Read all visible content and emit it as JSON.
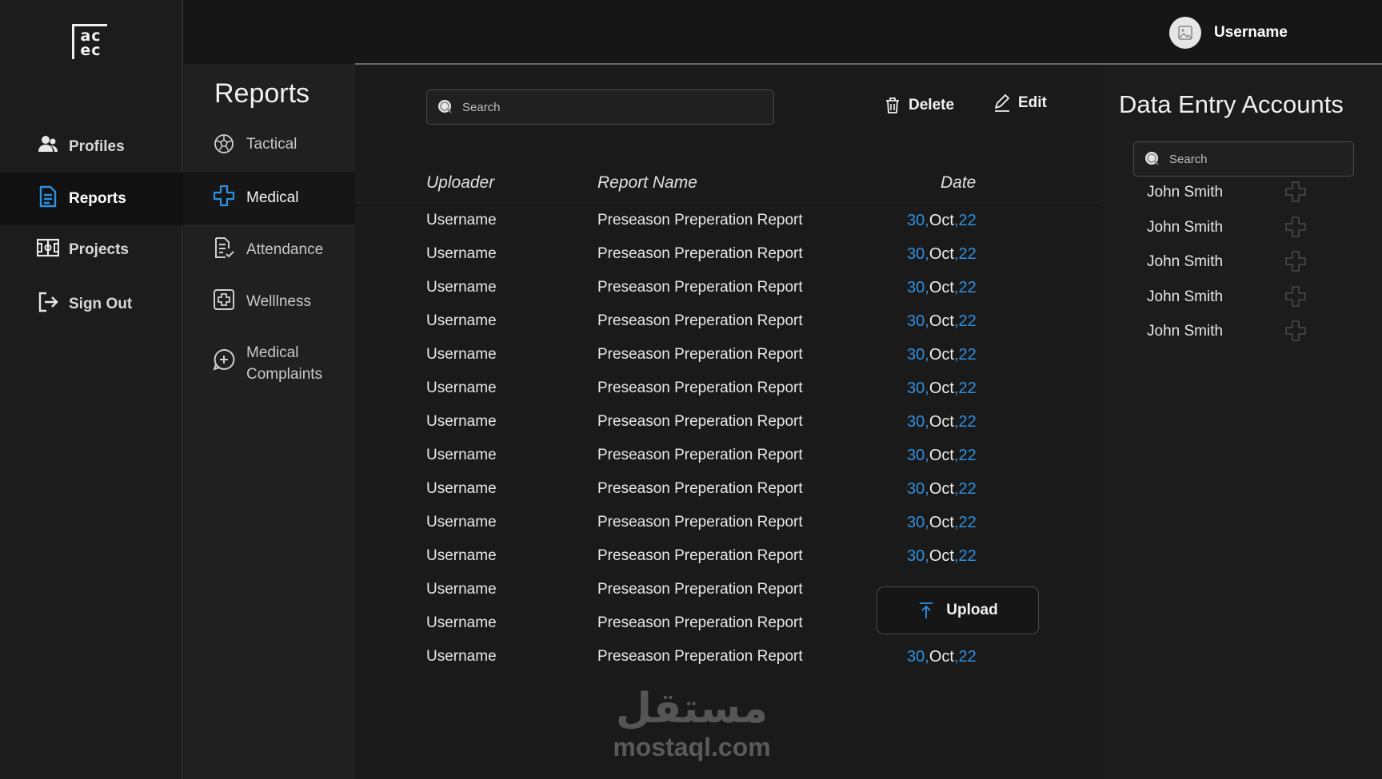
{
  "app": {
    "logo_text_top": "ac",
    "logo_text_bottom": "ec"
  },
  "user": {
    "name": "Username"
  },
  "sidebar": {
    "items": [
      {
        "label": "Profiles",
        "icon": "user-icon",
        "active": false
      },
      {
        "label": "Reports",
        "icon": "document-icon",
        "active": true
      },
      {
        "label": "Projects",
        "icon": "field-icon",
        "active": false
      },
      {
        "label": "Sign Out",
        "icon": "sign-out-icon",
        "active": false
      }
    ]
  },
  "subnav": {
    "title": "Reports",
    "items": [
      {
        "label": "Tactical",
        "icon": "soccer-ball-icon",
        "active": false
      },
      {
        "label": "Medical",
        "icon": "medical-cross-icon",
        "active": true
      },
      {
        "label": "Attendance",
        "icon": "attendance-icon",
        "active": false
      },
      {
        "label": "Welllness",
        "icon": "wellness-icon",
        "active": false
      },
      {
        "label": "Medical Complaints",
        "label_line1": "Medical",
        "label_line2": "Complaints",
        "icon": "complaint-icon",
        "active": false
      }
    ]
  },
  "toolbar": {
    "search_placeholder": "Search",
    "delete_label": "Delete",
    "edit_label": "Edit",
    "upload_label": "Upload"
  },
  "table": {
    "headers": [
      "Uploader",
      "Report Name",
      "Date"
    ],
    "rows": [
      {
        "uploader": "Username",
        "report": "Preseason Preperation Report",
        "day": "30",
        "month": "Oct",
        "year": "22"
      },
      {
        "uploader": "Username",
        "report": "Preseason Preperation Report",
        "day": "30",
        "month": "Oct",
        "year": "22"
      },
      {
        "uploader": "Username",
        "report": "Preseason Preperation Report",
        "day": "30",
        "month": "Oct",
        "year": "22"
      },
      {
        "uploader": "Username",
        "report": "Preseason Preperation Report",
        "day": "30",
        "month": "Oct",
        "year": "22"
      },
      {
        "uploader": "Username",
        "report": "Preseason Preperation Report",
        "day": "30",
        "month": "Oct",
        "year": "22"
      },
      {
        "uploader": "Username",
        "report": "Preseason Preperation Report",
        "day": "30",
        "month": "Oct",
        "year": "22"
      },
      {
        "uploader": "Username",
        "report": "Preseason Preperation Report",
        "day": "30",
        "month": "Oct",
        "year": "22"
      },
      {
        "uploader": "Username",
        "report": "Preseason Preperation Report",
        "day": "30",
        "month": "Oct",
        "year": "22"
      },
      {
        "uploader": "Username",
        "report": "Preseason Preperation Report",
        "day": "30",
        "month": "Oct",
        "year": "22"
      },
      {
        "uploader": "Username",
        "report": "Preseason Preperation Report",
        "day": "30",
        "month": "Oct",
        "year": "22"
      },
      {
        "uploader": "Username",
        "report": "Preseason Preperation Report",
        "day": "30",
        "month": "Oct",
        "year": "22"
      },
      {
        "uploader": "Username",
        "report": "Preseason Preperation Report",
        "day": "",
        "month": "",
        "year": ""
      },
      {
        "uploader": "Username",
        "report": "Preseason Preperation Report",
        "day": "",
        "month": "",
        "year": ""
      },
      {
        "uploader": "Username",
        "report": "Preseason Preperation Report",
        "day": "30",
        "month": "Oct",
        "year": "22"
      }
    ]
  },
  "right_panel": {
    "title": "Data Entry Accounts",
    "search_placeholder": "Search",
    "accounts": [
      "John Smith",
      "John Smith",
      "John Smith",
      "John Smith",
      "John Smith"
    ]
  },
  "watermark": {
    "arabic": "مستقل",
    "latin": "mostaql.com"
  },
  "colors": {
    "accent": "#2f8fe0",
    "background": "#161616",
    "panel": "#1c1c1c"
  }
}
